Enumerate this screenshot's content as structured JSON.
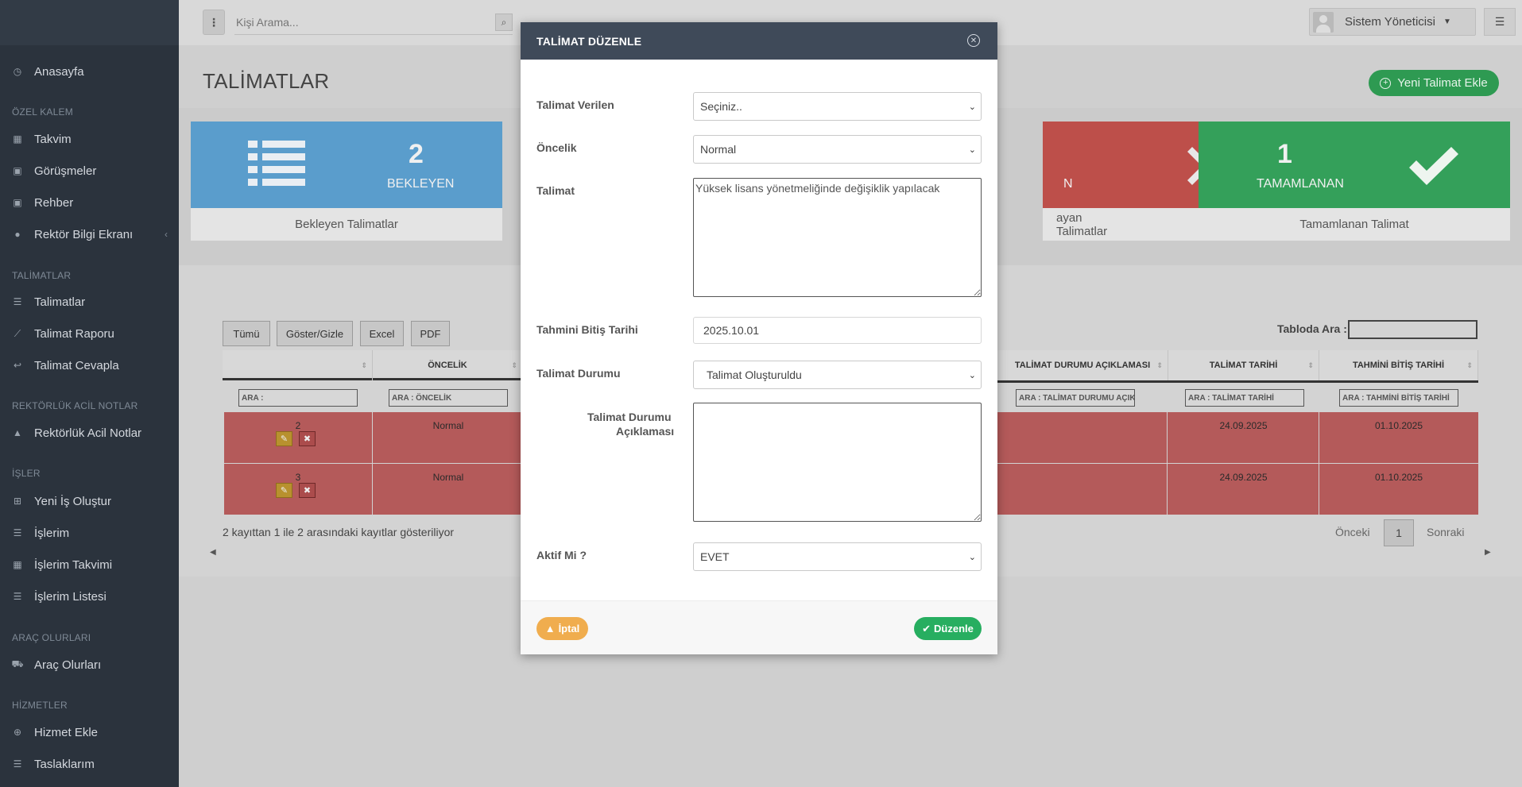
{
  "sidebar": {
    "home": "Anasayfa",
    "sections": [
      {
        "title": "ÖZEL KALEM",
        "items": [
          "Takvim",
          "Görüşmeler",
          "Rehber",
          "Rektör Bilgi Ekranı"
        ]
      },
      {
        "title": "TALİMATLAR",
        "items": [
          "Talimatlar",
          "Talimat Raporu",
          "Talimat Cevapla"
        ]
      },
      {
        "title": "REKTÖRLÜK ACİL NOTLAR",
        "items": [
          "Rektörlük Acil Notlar"
        ]
      },
      {
        "title": "İŞLER",
        "items": [
          "Yeni İş Oluştur",
          "İşlerim",
          "İşlerim Takvimi",
          "İşlerim Listesi"
        ]
      },
      {
        "title": "ARAÇ OLURLARI",
        "items": [
          "Araç Olurları"
        ]
      },
      {
        "title": "HİZMETLER",
        "items": [
          "Hizmet Ekle",
          "Taslaklarım"
        ]
      }
    ]
  },
  "topbar": {
    "search_placeholder": "Kişi Arama...",
    "user_name": "Sistem Yöneticisi"
  },
  "page": {
    "title": "TALİMATLAR",
    "new_button": "Yeni Talimat Ekle"
  },
  "cards": [
    {
      "count": "2",
      "label": "BEKLEYEN",
      "footer": "Bekleyen Talimatlar",
      "color": "#5aa0cf"
    },
    {
      "count": "",
      "label": "N",
      "footer": "ayan Talimatlar",
      "color": "#c0504a"
    },
    {
      "count": "1",
      "label": "TAMAMLANAN",
      "footer": "Tamamlanan Talimat",
      "color": "#35a35c"
    }
  ],
  "table": {
    "buttons": [
      "Tümü",
      "Göster/Gizle",
      "Excel",
      "PDF"
    ],
    "search_label": "Tabloda Ara :",
    "headers": [
      "",
      "ÖNCELİK",
      "TALİMAT DURUMU AÇIKLAMASI",
      "TALİMAT TARİHİ",
      "TAHMİNİ BİTİŞ TARİHİ"
    ],
    "filters": [
      "ARA :",
      "ARA : ÖNCELİK",
      "ARA : TALİMAT DURUMU AÇIKLAMASI",
      "ARA : TALİMAT TARİHİ",
      "ARA : TAHMİNİ BİTİŞ TARİHİ"
    ],
    "rows": [
      {
        "id": "2",
        "priority": "Normal",
        "date": "24.09.2025",
        "end": "01.10.2025"
      },
      {
        "id": "3",
        "priority": "Normal",
        "date": "24.09.2025",
        "end": "01.10.2025"
      }
    ],
    "info": "2 kayıttan 1 ile 2 arasındaki kayıtlar gösteriliyor",
    "prev": "Önceki",
    "page": "1",
    "next": "Sonraki"
  },
  "modal": {
    "title": "TALİMAT DÜZENLE",
    "fields": {
      "assignee_label": "Talimat Verilen",
      "assignee_value": "Seçiniz..",
      "priority_label": "Öncelik",
      "priority_value": "Normal",
      "instruction_label": "Talimat",
      "instruction_value": "Yüksek lisans yönetmeliğinde değişiklik yapılacak",
      "end_date_label": "Tahmini Bitiş Tarihi",
      "end_date_value": "2025.10.01",
      "status_label": "Talimat Durumu",
      "status_value": "Talimat Oluşturuldu",
      "status_desc_label_1": "Talimat Durumu",
      "status_desc_label_2": "Açıklaması",
      "status_desc_value": "",
      "active_label": "Aktif Mi ?",
      "active_value": "EVET"
    },
    "cancel": "İptal",
    "save": "Düzenle"
  }
}
